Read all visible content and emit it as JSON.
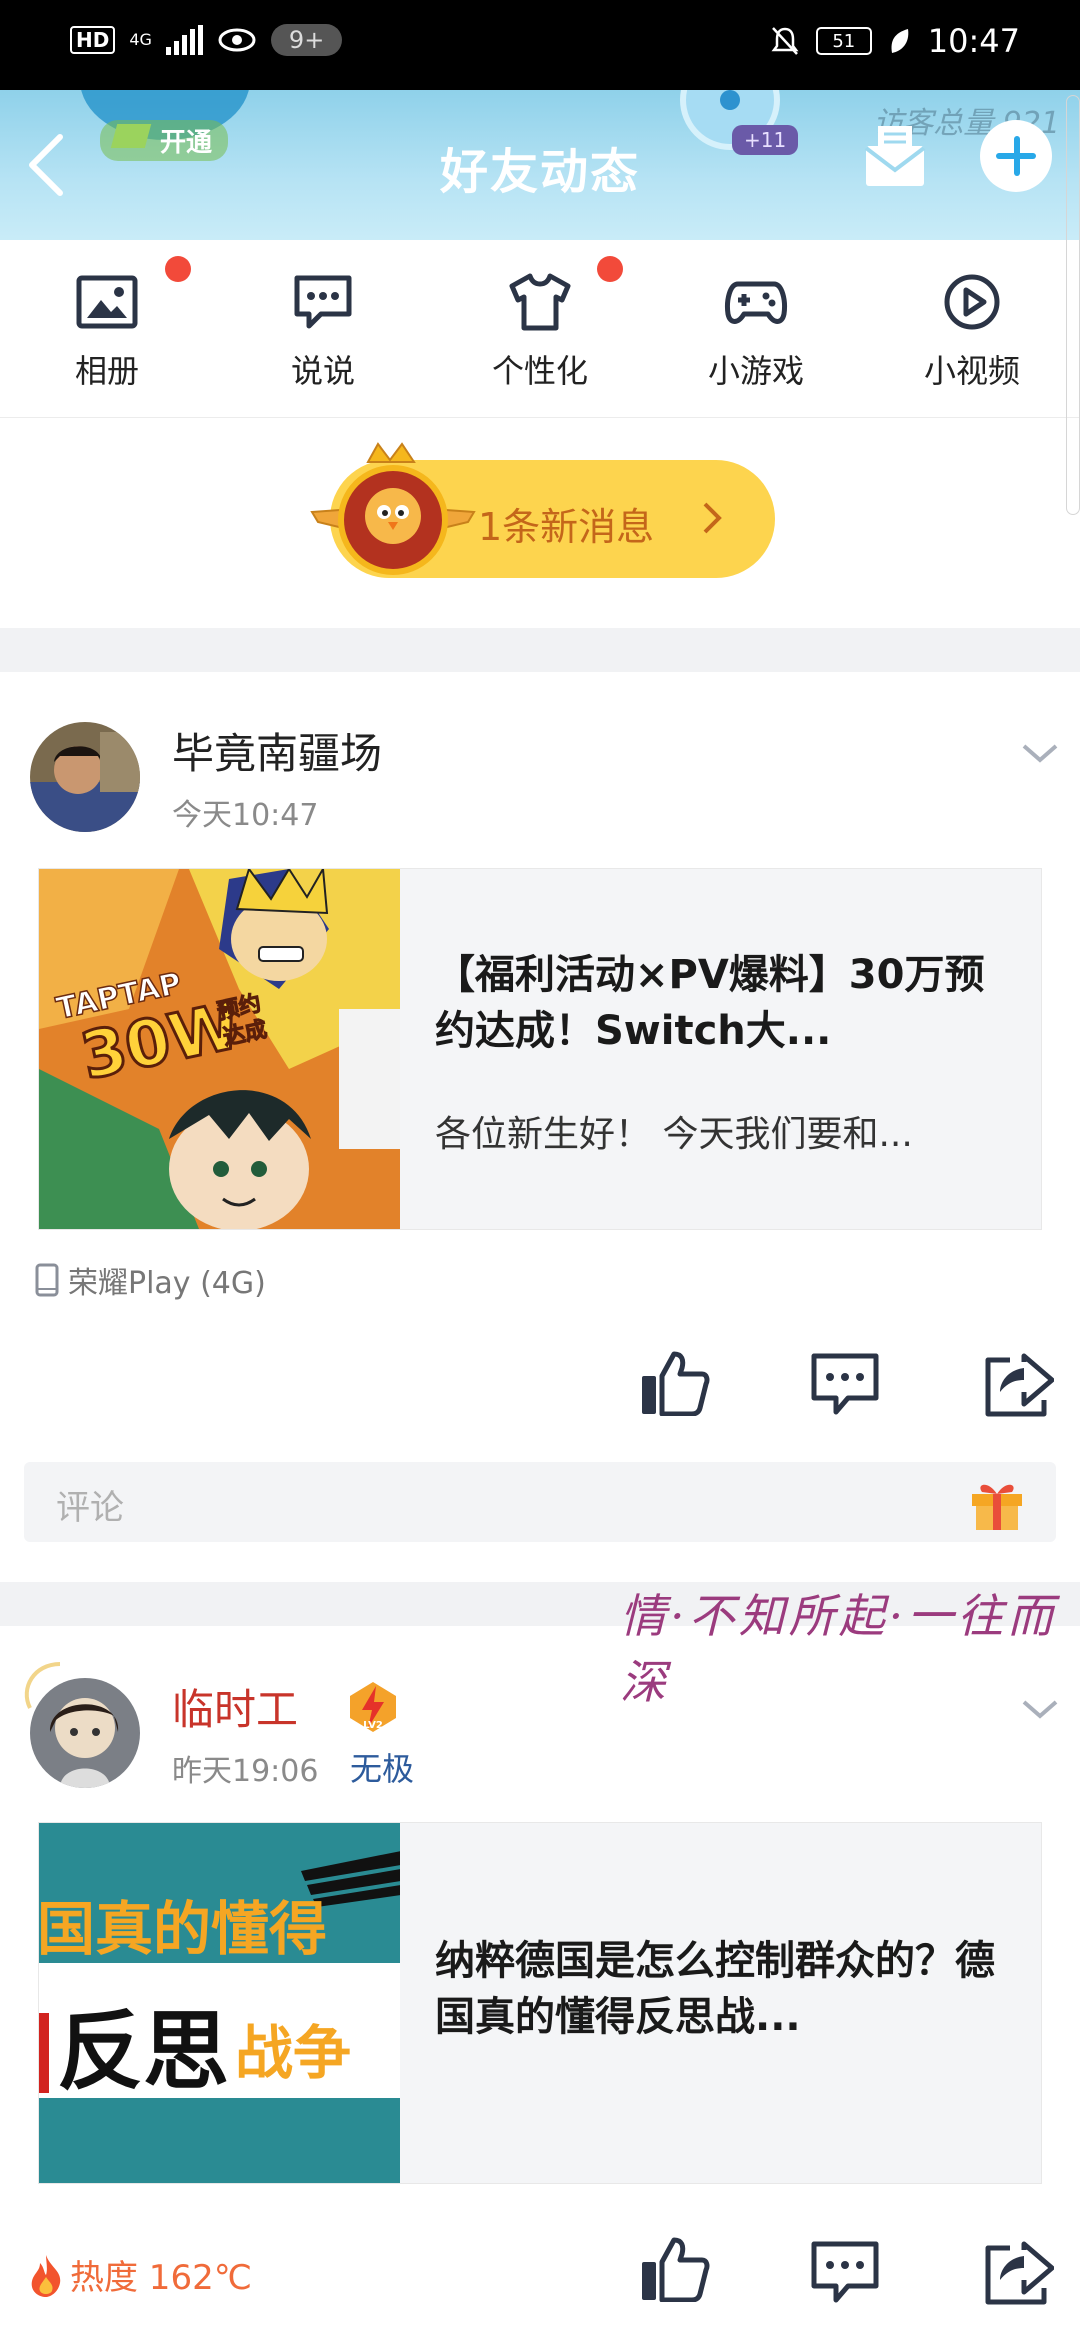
{
  "status_bar": {
    "left": {
      "hd": "HD",
      "network": "4G",
      "notifications": "9+"
    },
    "right": {
      "battery": "51",
      "time": "10:47"
    }
  },
  "header": {
    "title": "好友动态",
    "kaitong": "开通",
    "visitors": "访客总量 921",
    "badge": "+11"
  },
  "shortcuts": [
    {
      "label": "相册",
      "icon": "photo-icon",
      "dot": true
    },
    {
      "label": "说说",
      "icon": "chat-bubble-icon",
      "dot": false
    },
    {
      "label": "个性化",
      "icon": "tshirt-icon",
      "dot": true
    },
    {
      "label": "小游戏",
      "icon": "gamepad-icon",
      "dot": false
    },
    {
      "label": "小视频",
      "icon": "play-circle-icon",
      "dot": false
    }
  ],
  "new_messages": {
    "label": "1条新消息"
  },
  "posts": [
    {
      "user": "毕竟南疆场",
      "time": "今天10:47",
      "card_title": "【福利活动×PV爆料】30万预约达成！Switch大...",
      "card_desc": "各位新生好！ 今天我们要和...",
      "thumb_text": "TAPTAP 30W 预约达成",
      "device": "荣耀Play (4G)",
      "comment_placeholder": "评论"
    },
    {
      "user": "临时工",
      "time": "昨天19:06",
      "tag": "无极",
      "level": "LV2",
      "card_title": "纳粹德国是怎么控制群众的？德国真的懂得反思战...",
      "thumb_line1": "国真的懂得",
      "thumb_line2a": "反思",
      "thumb_line2b": "战争",
      "heat": "热度 162℃"
    }
  ],
  "decor_banner": "情·不知所起·一往而深",
  "colors": {
    "accent_blue": "#28a8e8",
    "new_msg_yellow": "#fdd44e",
    "red_dot": "#f24a3a",
    "username_red": "#c8342a"
  }
}
